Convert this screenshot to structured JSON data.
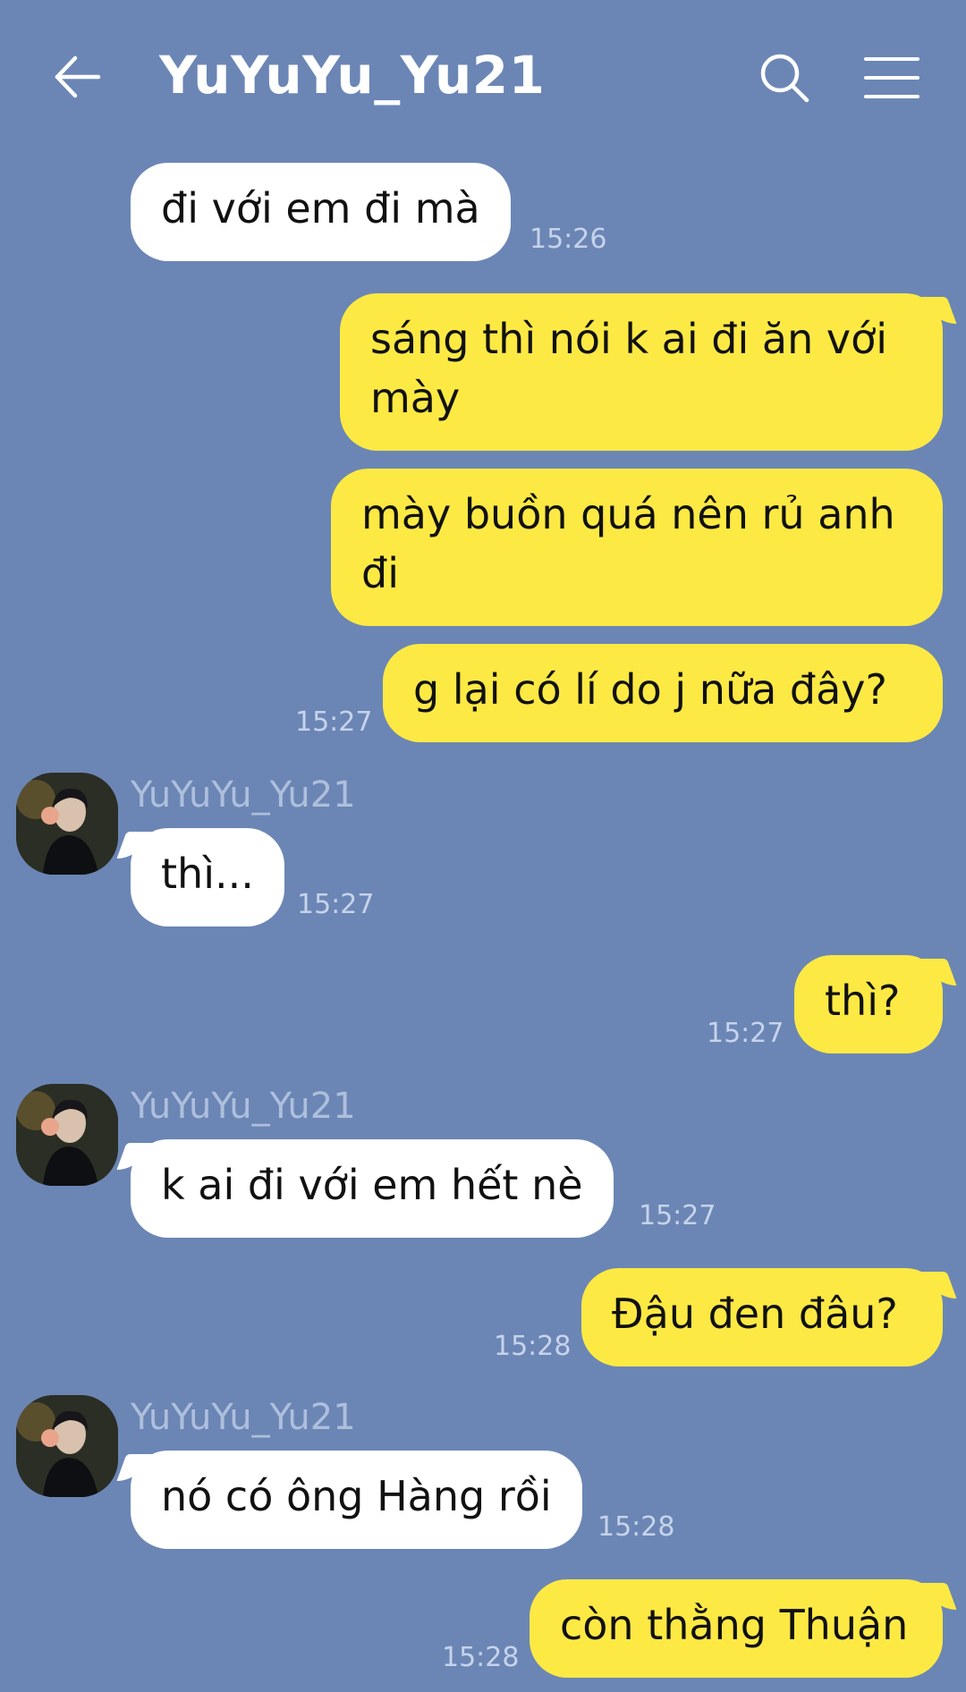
{
  "header": {
    "title": "YuYuYu_Yu21",
    "back_icon": "arrow-left-icon",
    "search_icon": "search-icon",
    "menu_icon": "hamburger-menu-icon"
  },
  "colors": {
    "background": "#6b86b5",
    "incoming_bubble": "#ffffff",
    "outgoing_bubble": "#fde944",
    "timestamp": "#c6d3ea",
    "sender_name": "#aebfdc"
  },
  "messages": [
    {
      "direction": "in",
      "text": "đi với em đi mà",
      "time": "15:26"
    },
    {
      "direction": "out",
      "text": "sáng thì nói k ai đi ăn với mày",
      "time": ""
    },
    {
      "direction": "out",
      "text": "mày buồn quá nên rủ anh đi",
      "time": ""
    },
    {
      "direction": "out",
      "text": "g lại có lí do j nữa đây?",
      "time": "15:27"
    },
    {
      "direction": "in",
      "sender": "YuYuYu_Yu21",
      "text": "thì...",
      "time": "15:27"
    },
    {
      "direction": "out",
      "text": "thì?",
      "time": "15:27"
    },
    {
      "direction": "in",
      "sender": "YuYuYu_Yu21",
      "text": "k ai đi với em hết nè",
      "time": "15:27"
    },
    {
      "direction": "out",
      "text": "Đậu đen đâu?",
      "time": "15:28"
    },
    {
      "direction": "in",
      "sender": "YuYuYu_Yu21",
      "text": "nó có ông Hàng rồi",
      "time": "15:28"
    },
    {
      "direction": "out",
      "text": "còn thằng Thuận",
      "time": "15:28"
    }
  ]
}
